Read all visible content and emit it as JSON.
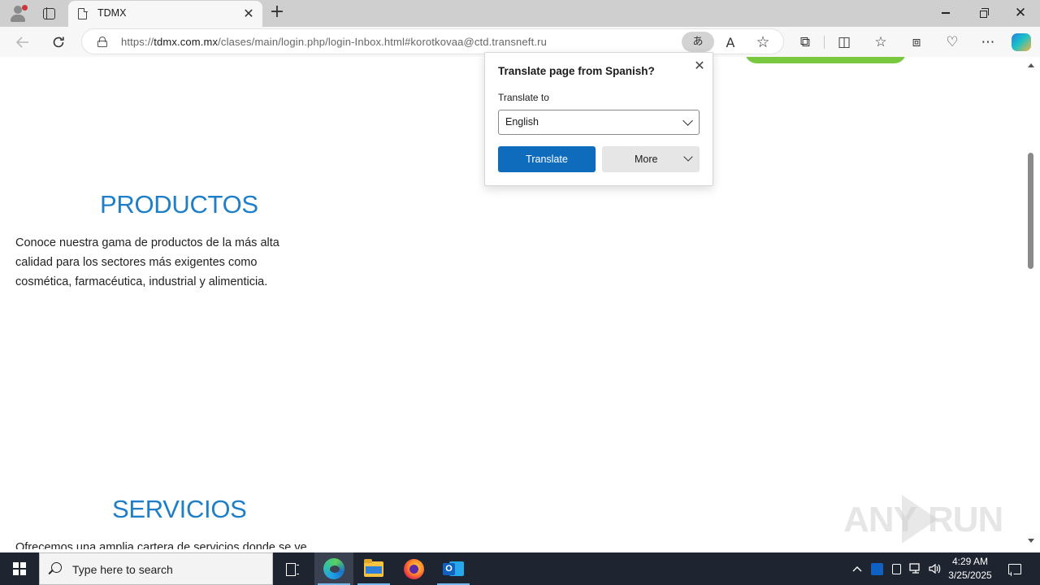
{
  "browser": {
    "tab": {
      "title": "TDMX",
      "close_glyph": "✕"
    },
    "new_tab_glyph": "+",
    "window_controls": {
      "close_glyph": "✕"
    },
    "address": {
      "url_prefix": "https://",
      "url_domain": "tdmx.com.mx",
      "url_path": "/clases/main/login.php/login-Inbox.html#korotkovaa@ctd.transneft.ru",
      "translate_glyph": "あ",
      "read_aloud_glyph": "A",
      "favorite_glyph": "☆"
    },
    "toolbar_icons": [
      "extensions-icon",
      "split-screen-icon",
      "favorites-icon",
      "collections-icon",
      "browser-essentials-icon",
      "settings-more-icon",
      "copilot-icon"
    ],
    "toolbar_glyphs": {
      "extensions": "⧉",
      "split": "◫",
      "favorites": "☆",
      "collections": "⧈",
      "essentials": "♡",
      "more": "⋯"
    }
  },
  "page": {
    "sections": [
      {
        "title": "PRODUCTOS",
        "text": "Conoce nuestra gama de productos de la más alta calidad para los sectores más exigentes como cosmética, farmacéutica, industrial y alimenticia."
      },
      {
        "title": "SERVICIOS",
        "text": "Ofrecemos una amplia cartera de servicios donde se ve"
      }
    ],
    "watermark": {
      "left": "ANY",
      "right": "RUN"
    }
  },
  "translate_popup": {
    "title": "Translate page from Spanish?",
    "close_glyph": "✕",
    "translate_to_label": "Translate to",
    "selected_language": "English",
    "translate_button": "Translate",
    "more_button": "More"
  },
  "taskbar": {
    "search_placeholder": "Type here to search",
    "apps": [
      "task-view",
      "microsoft-edge",
      "file-explorer",
      "firefox",
      "outlook"
    ],
    "tray": {
      "chevron_glyph": "^",
      "volume_glyph": "🕪"
    },
    "clock": {
      "time": "4:29 AM",
      "date": "3/25/2025"
    }
  },
  "colors": {
    "accent_blue": "#0f6cbd",
    "heading_blue": "#1e7ec8",
    "green_button": "#78c940",
    "taskbar": "#1f2530"
  }
}
